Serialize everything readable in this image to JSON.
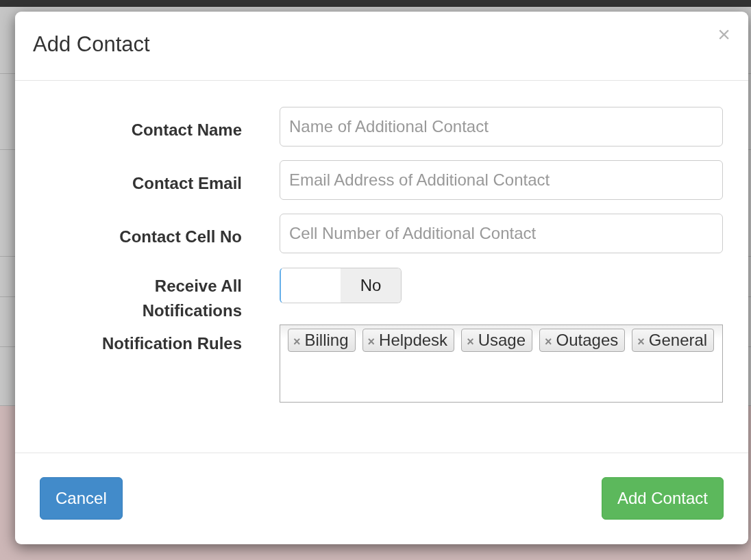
{
  "dialog": {
    "title": "Add Contact",
    "close": "×",
    "fields": [
      {
        "kind": "text",
        "label": "Contact Name",
        "placeholder": "Name of Additional Contact"
      },
      {
        "kind": "text",
        "label": "Contact Email",
        "placeholder": "Email Address of Additional Contact"
      },
      {
        "kind": "text",
        "label": "Contact Cell No",
        "placeholder": "Cell Number of Additional Contact"
      },
      {
        "kind": "switch",
        "label": "Receive All Notifications",
        "on": false,
        "off_label": "No"
      },
      {
        "kind": "tags",
        "label": "Notification Rules",
        "tags": [
          {
            "label": "Billing",
            "remove": "×"
          },
          {
            "label": "Helpdesk",
            "remove": "×"
          },
          {
            "label": "Usage",
            "remove": "×"
          },
          {
            "label": "Outages",
            "remove": "×"
          },
          {
            "label": "General",
            "remove": "×"
          }
        ]
      }
    ],
    "buttons": [
      {
        "label": "Cancel",
        "kind": "default"
      },
      {
        "label": "Add Contact",
        "kind": "primary"
      }
    ]
  }
}
